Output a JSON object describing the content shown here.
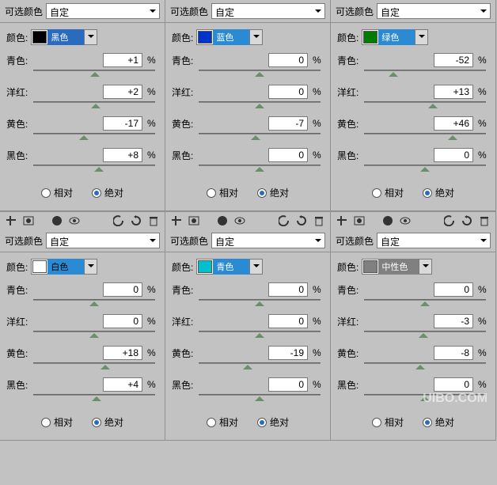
{
  "labels": {
    "selectable_color": "可选颜色",
    "preset": "自定",
    "color": "颜色:",
    "sliders": [
      "青色:",
      "洋红:",
      "黄色:",
      "黑色:"
    ],
    "percent": "%",
    "relative": "相对",
    "absolute": "绝对"
  },
  "panels": [
    {
      "color_name": "黑色",
      "swatch": "#000000",
      "label_bg": "#2a6abf",
      "values": [
        "+1",
        "+2",
        "-17",
        "+8"
      ],
      "method": "absolute"
    },
    {
      "color_name": "蓝色",
      "swatch": "#0033cc",
      "label_bg": "#2a8ad4",
      "values": [
        "0",
        "0",
        "-7",
        "0"
      ],
      "method": "absolute"
    },
    {
      "color_name": "绿色",
      "swatch": "#007a00",
      "label_bg": "#2a8ad4",
      "values": [
        "-52",
        "+13",
        "+46",
        "0"
      ],
      "method": "absolute"
    },
    {
      "color_name": "白色",
      "swatch": "#ffffff",
      "label_bg": "#2a8ad4",
      "values": [
        "0",
        "0",
        "+18",
        "+4"
      ],
      "method": "absolute"
    },
    {
      "color_name": "青色",
      "swatch": "#00bfcf",
      "label_bg": "#2a8ad4",
      "values": [
        "0",
        "0",
        "-19",
        "0"
      ],
      "method": "absolute"
    },
    {
      "color_name": "中性色",
      "swatch": "#808080",
      "label_bg": "#808080",
      "values": [
        "0",
        "-3",
        "-8",
        "0"
      ],
      "method": "absolute"
    }
  ],
  "watermark": "UIBO.COM"
}
